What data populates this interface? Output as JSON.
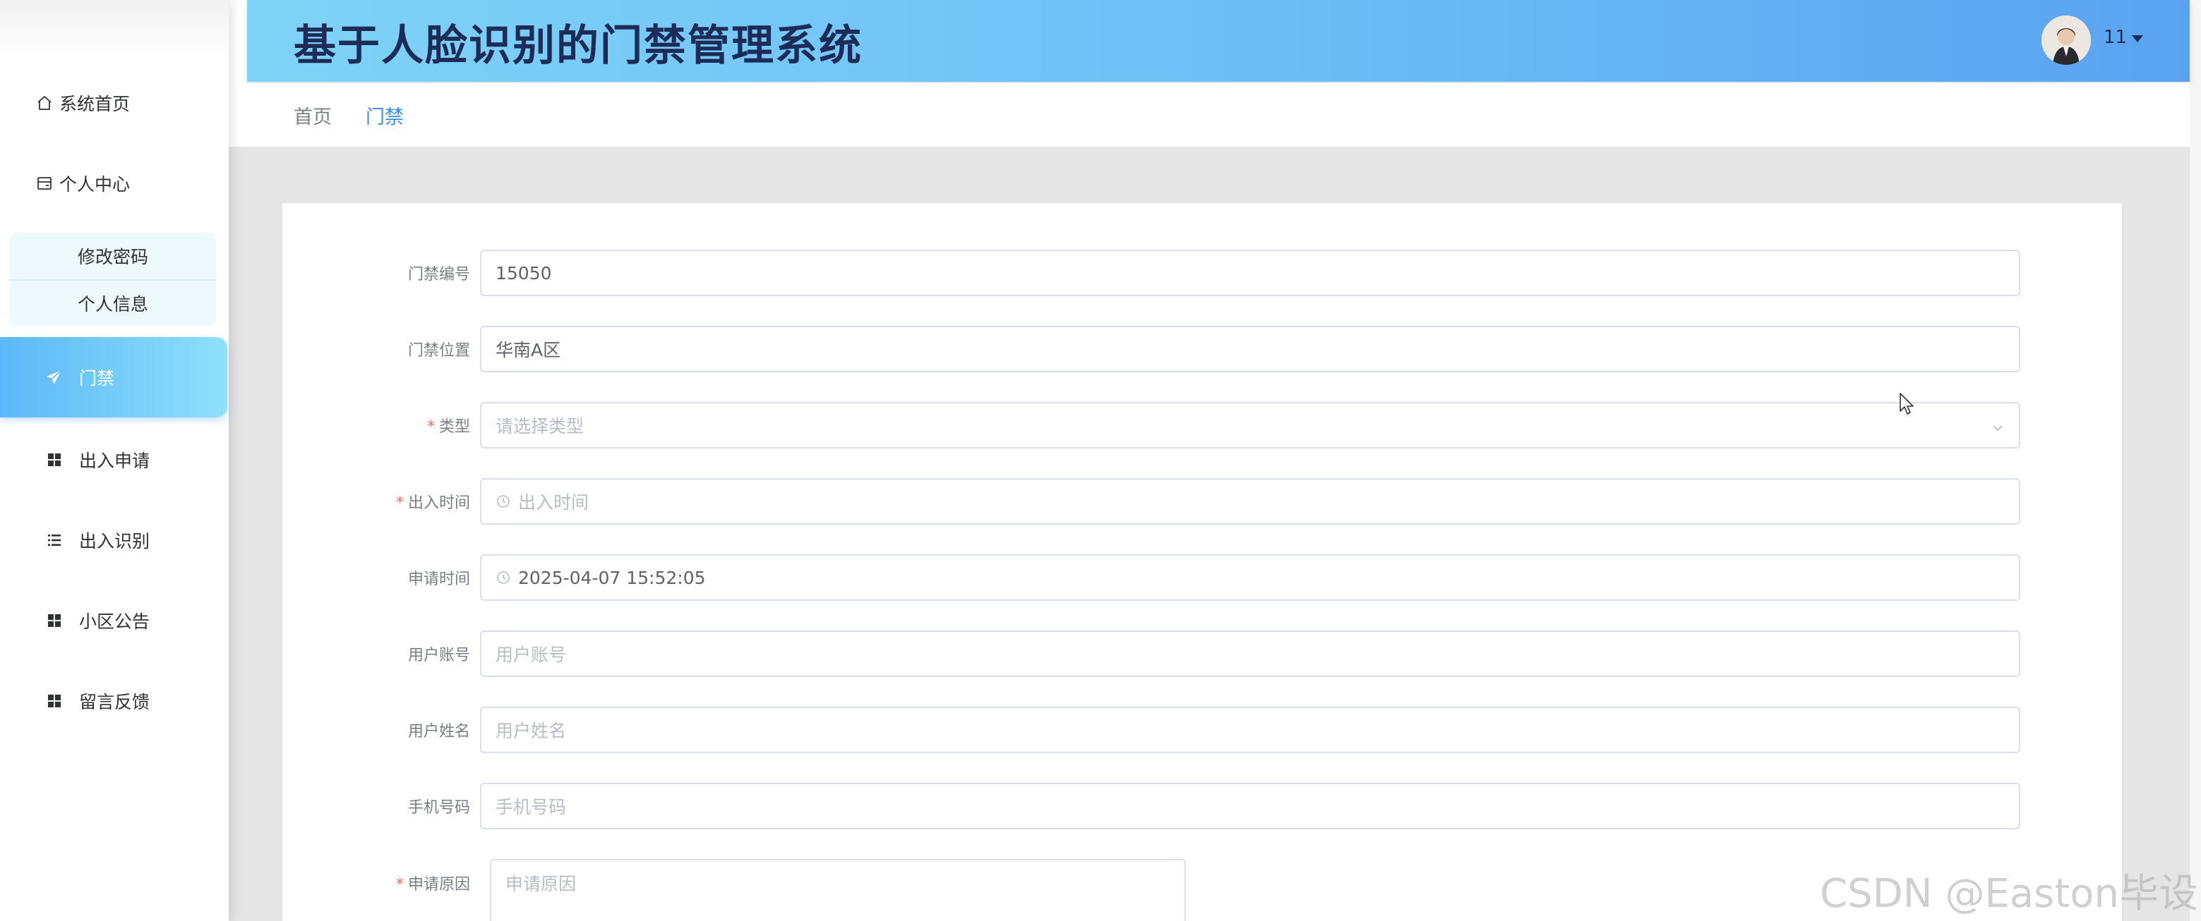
{
  "header": {
    "title": "基于人脸识别的门禁管理系统",
    "user_name": "11"
  },
  "breadcrumb": {
    "home": "首页",
    "current": "门禁"
  },
  "sidebar": {
    "items": [
      {
        "label": "系统首页",
        "icon": "home-icon"
      },
      {
        "label": "个人中心",
        "icon": "card-icon"
      },
      {
        "label": "门禁",
        "icon": "paper-plane-icon",
        "active": true
      },
      {
        "label": "出入申请",
        "icon": "grid-icon"
      },
      {
        "label": "出入识别",
        "icon": "list-icon"
      },
      {
        "label": "小区公告",
        "icon": "grid-icon"
      },
      {
        "label": "留言反馈",
        "icon": "grid-icon"
      }
    ],
    "submenu": [
      "修改密码",
      "个人信息"
    ]
  },
  "form": {
    "fields": [
      {
        "label": "门禁编号",
        "value": "15050",
        "placeholder": "",
        "required": false
      },
      {
        "label": "门禁位置",
        "value": "华南A区",
        "placeholder": "",
        "required": false
      },
      {
        "label": "类型",
        "value": "",
        "placeholder": "请选择类型",
        "required": true
      },
      {
        "label": "出入时间",
        "value": "",
        "placeholder": "出入时间",
        "required": true
      },
      {
        "label": "申请时间",
        "value": "2025-04-07 15:52:05",
        "placeholder": "",
        "required": false
      },
      {
        "label": "用户账号",
        "value": "",
        "placeholder": "用户账号",
        "required": false
      },
      {
        "label": "用户姓名",
        "value": "",
        "placeholder": "用户姓名",
        "required": false
      },
      {
        "label": "手机号码",
        "value": "",
        "placeholder": "手机号码",
        "required": false
      }
    ],
    "reason": {
      "label": "申请原因",
      "placeholder": "申请原因",
      "required": true
    },
    "required_mark": "*"
  },
  "watermark": "CSDN @Easton毕设",
  "colors": {
    "accent": "#5cb8f7",
    "header_start": "#7fd3f6",
    "header_end": "#5aa3f1",
    "required": "#f56c6c",
    "breadcrumb_active": "#3c8dd8"
  }
}
